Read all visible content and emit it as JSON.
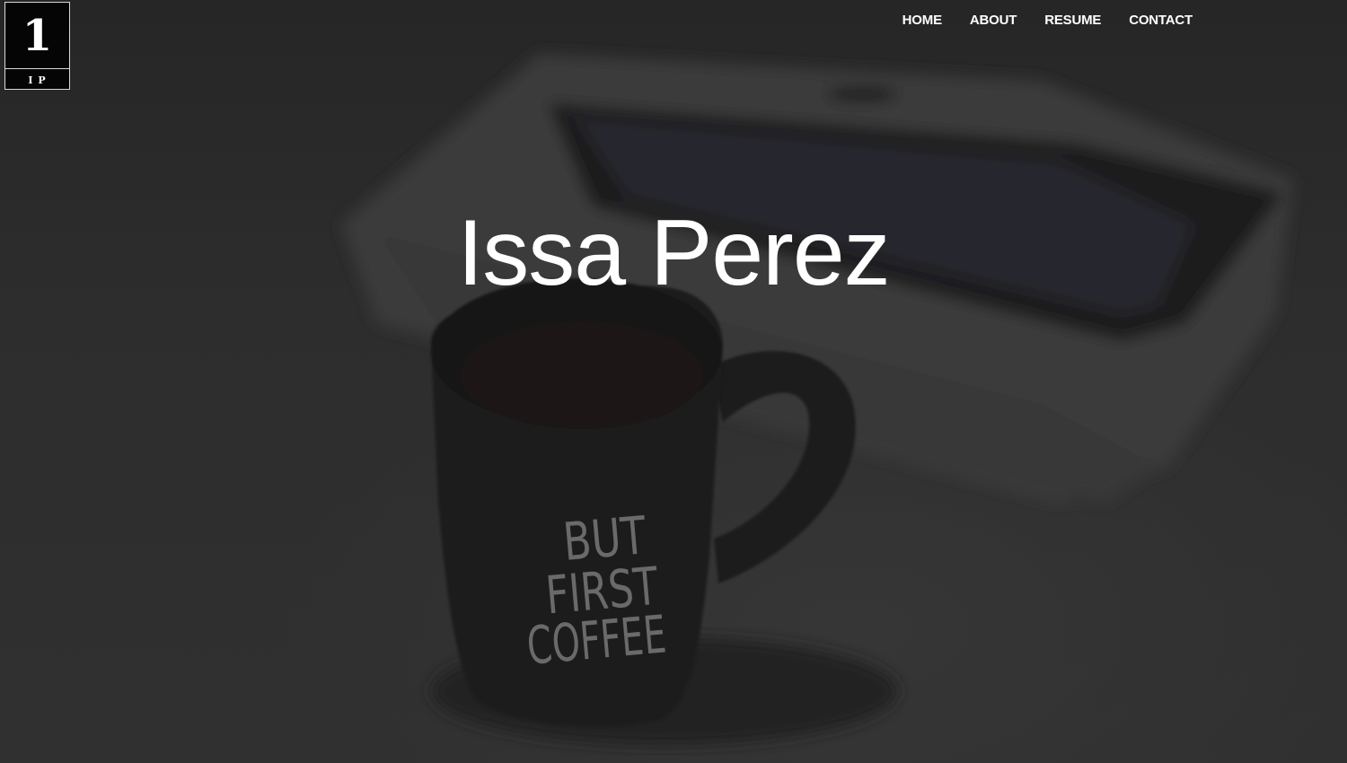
{
  "logo": {
    "mark": "1",
    "initials": "I P"
  },
  "nav": {
    "items": [
      {
        "label": "HOME"
      },
      {
        "label": "ABOUT"
      },
      {
        "label": "RESUME"
      },
      {
        "label": "CONTACT"
      }
    ]
  },
  "hero": {
    "title": "Issa Perez",
    "mug_text": [
      "BUT",
      "FIRST",
      "COFFEE"
    ]
  },
  "colors": {
    "overlay": "#2b2b2b",
    "text": "#ffffff",
    "logo_background": "#050505"
  }
}
